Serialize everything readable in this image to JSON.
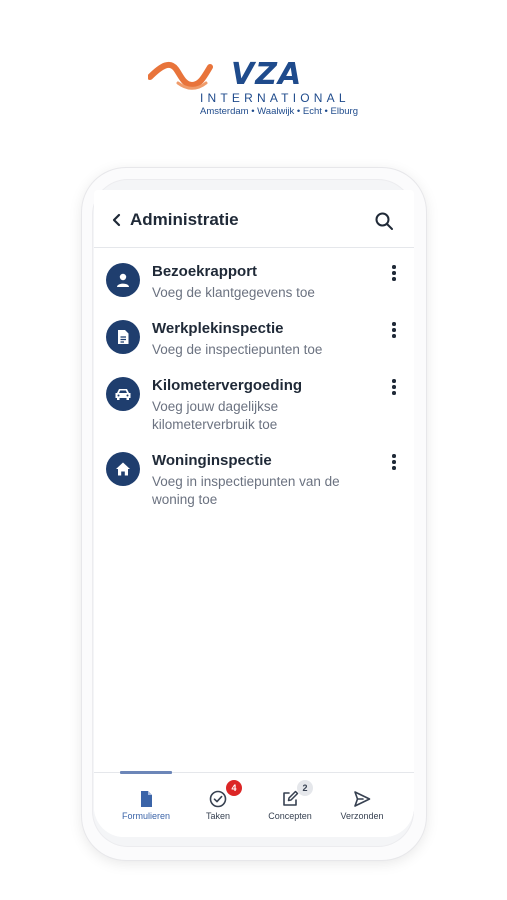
{
  "logo": {
    "brand": "VZA",
    "subtitle": "INTERNATIONAL",
    "locations": "Amsterdam • Waalwijk • Echt • Elburg"
  },
  "header": {
    "title": "Administratie",
    "back_icon": "chevron-left-icon",
    "search_icon": "search-icon"
  },
  "forms": [
    {
      "title": "Bezoekrapport",
      "subtitle": "Voeg de klantgegevens toe",
      "icon": "person-icon"
    },
    {
      "title": "Werkplekinspectie",
      "subtitle": "Voeg de inspectiepunten toe",
      "icon": "document-icon"
    },
    {
      "title": "Kilometervergoeding",
      "subtitle": "Voeg jouw dagelijkse kilometerverbruik toe",
      "icon": "car-icon"
    },
    {
      "title": "Woninginspectie",
      "subtitle": "Voeg in inspectiepunten van de woning toe",
      "icon": "home-icon"
    }
  ],
  "bottom_nav": {
    "items": [
      {
        "label": "Formulieren",
        "icon": "file-icon",
        "active": true
      },
      {
        "label": "Taken",
        "icon": "check-circle-icon",
        "badge": "4"
      },
      {
        "label": "Concepten",
        "icon": "edit-icon",
        "badge": "2"
      },
      {
        "label": "Verzonden",
        "icon": "send-icon"
      }
    ]
  },
  "colors": {
    "brand_blue": "#1f4b8c",
    "brand_orange": "#e8743b",
    "icon_bg": "#1f3e6e",
    "active_nav": "#3b64a8",
    "badge_red": "#dc2626"
  }
}
